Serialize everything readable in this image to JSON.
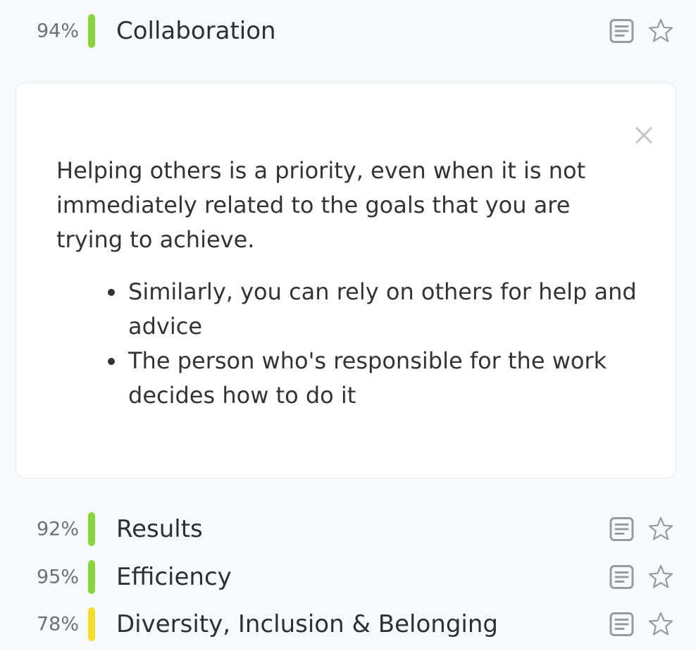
{
  "categories": [
    {
      "percent": "94%",
      "label": "Collaboration",
      "bar_color": "#8ad53e"
    },
    {
      "percent": "92%",
      "label": "Results",
      "bar_color": "#8ad53e"
    },
    {
      "percent": "95%",
      "label": "Efficiency",
      "bar_color": "#8ad53e"
    },
    {
      "percent": "78%",
      "label": "Diversity, Inclusion & Belonging",
      "bar_color": "#f5dd2b"
    }
  ],
  "expanded_card": {
    "description": "Helping others is a priority, even when it is not immediately related to the goals that you are trying to achieve.",
    "bullets": [
      "Similarly, you can rely on others for help and advice",
      "The person who's responsible for the work decides how to do it"
    ],
    "close_icon": "close-icon"
  },
  "icons": {
    "note": "note-icon",
    "star": "star-outline-icon"
  },
  "colors": {
    "background": "#f6fafd",
    "card_background": "#ffffff",
    "icon_gray": "#9a9a9a",
    "green": "#8ad53e",
    "yellow": "#f5dd2b"
  }
}
